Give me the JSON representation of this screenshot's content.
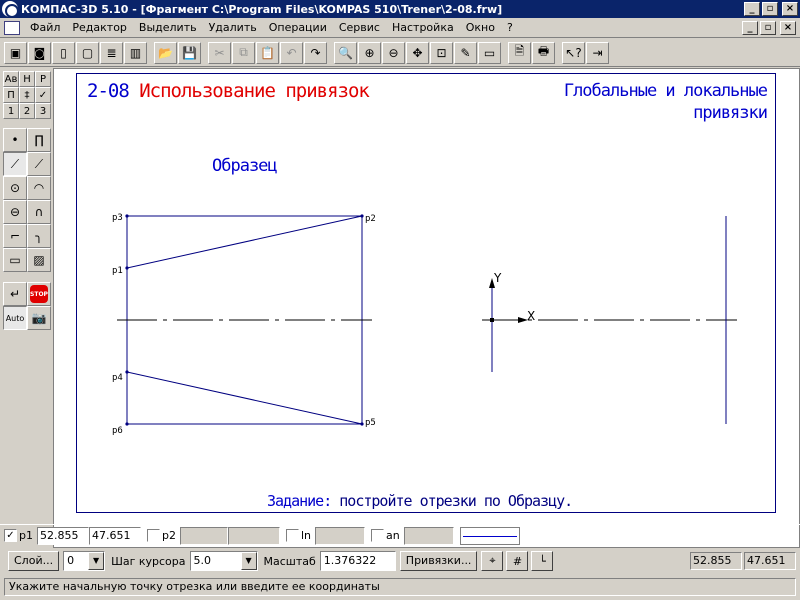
{
  "window": {
    "title": "КОМПАС-3D 5.10 - [Фрагмент C:\\Program Files\\KOMPAS 510\\Trener\\2-08.frw]"
  },
  "menu": [
    "Файл",
    "Редактор",
    "Выделить",
    "Удалить",
    "Операции",
    "Сервис",
    "Настройка",
    "Окно",
    "?"
  ],
  "left_panel": {
    "tabs": [
      "Ав",
      "Н",
      "Р",
      "П",
      "‡",
      "✓",
      "1",
      "2",
      "3"
    ],
    "tools": [
      "point",
      "line-curve",
      "segment",
      "parallel-segment",
      "circle",
      "arc",
      "ellipse",
      "spline",
      "chamfer",
      "fillet",
      "rectangle",
      "hatch"
    ],
    "auto_label": "Auto",
    "stop_label": "STOP"
  },
  "drawing": {
    "lesson_number": "2-08",
    "lesson_title": "Использование привязок",
    "topic_line1": "Глобальные и локальные",
    "topic_line2": "привязки",
    "sample_label": "Образец",
    "task_label": "Задание:",
    "task_text": "постройте отрезки по Образцу.",
    "point_labels": [
      "p1",
      "p2",
      "p3",
      "p4",
      "p5",
      "p6"
    ],
    "axis_x": "X",
    "axis_y": "Y",
    "line_color": "#000080"
  },
  "coords": {
    "p1_label": "p1",
    "p1_x": "52.855",
    "p1_y": "47.651",
    "p2_label": "p2",
    "ln_label": "ln",
    "an_label": "an"
  },
  "params": {
    "layer_button": "Слой...",
    "layer_value": "0",
    "step_label": "Шаг курсора",
    "step_value": "5.0",
    "scale_label": "Масштаб",
    "scale_value": "1.376322",
    "snaps_button": "Привязки...",
    "cursor_x": "52.855",
    "cursor_y": "47.651"
  },
  "status": {
    "text": "Укажите начальную точку отрезка или введите ее координаты"
  }
}
